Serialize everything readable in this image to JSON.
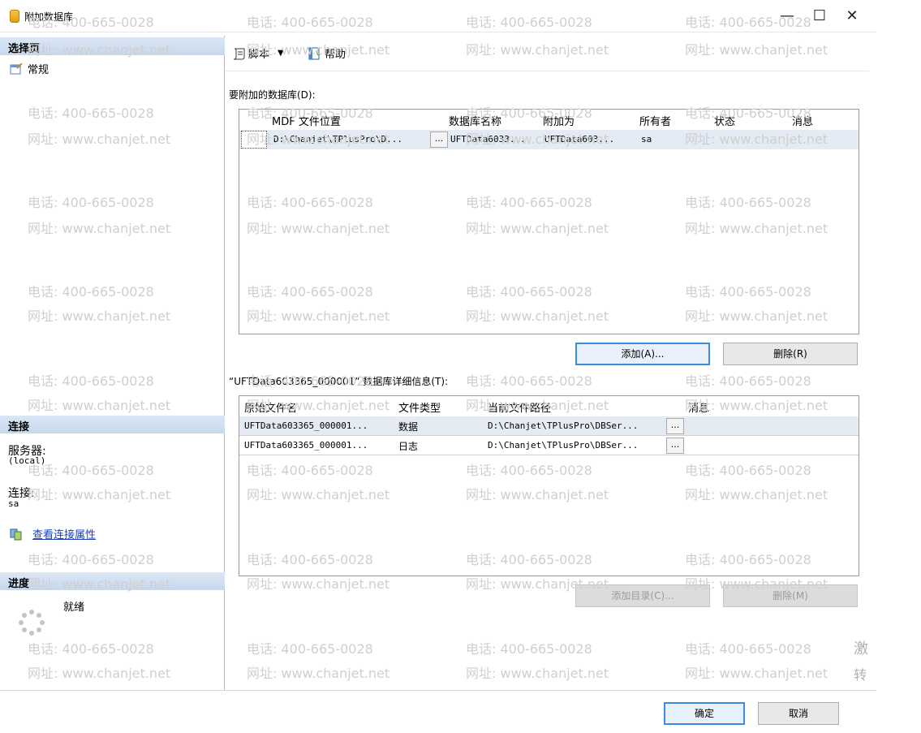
{
  "window": {
    "title": "附加数据库",
    "minimize": "—",
    "maximize": "☐",
    "close": "✕"
  },
  "left": {
    "select_page": "选择页",
    "pages": [
      "常规"
    ],
    "connection": {
      "header": "连接",
      "server_label": "服务器:",
      "server_value": "(local)",
      "conn_label": "连接:",
      "conn_value": "sa",
      "view_props": "查看连接属性"
    },
    "progress": {
      "header": "进度",
      "status": "就绪"
    }
  },
  "toolbar": {
    "script": "脚本",
    "help": "帮助"
  },
  "attach": {
    "label": "要附加的数据库(D):",
    "columns": [
      "MDF 文件位置",
      "数据库名称",
      "附加为",
      "所有者",
      "状态",
      "消息"
    ],
    "rows": [
      {
        "mdf": "D:\\Chanjet\\TPlusPro\\D...",
        "dbname": "UFTData6033...",
        "attach_as": "UFTData603...",
        "owner": "sa",
        "status": "",
        "message": ""
      }
    ],
    "add_button": "添加(A)...",
    "remove_button": "删除(R)"
  },
  "details": {
    "label": "“UFTData603365_000001” 数据库详细信息(T):",
    "columns": [
      "原始文件名",
      "文件类型",
      "当前文件路径",
      "消息"
    ],
    "rows": [
      {
        "name": "UFTData603365_000001...",
        "type": "数据",
        "path": "D:\\Chanjet\\TPlusPro\\DBSer...",
        "message": ""
      },
      {
        "name": "UFTData603365_000001...",
        "type": "日志",
        "path": "D:\\Chanjet\\TPlusPro\\DBSer...",
        "message": ""
      }
    ],
    "add_catalog_button": "添加目录(C)...",
    "remove_button": "删除(M)"
  },
  "footer": {
    "ok": "确定",
    "cancel": "取消"
  },
  "cell_button": "...",
  "watermark": {
    "phone": "电话: 400-665-0028",
    "site": "网址: www.chanjet.net",
    "side_1": "激",
    "side_2": "转"
  },
  "colors": {
    "section_bg": "#c7d8ee",
    "selected_row": "#e4ebf5",
    "primary_border": "#3c8cdc",
    "link": "#1a3fbf"
  }
}
